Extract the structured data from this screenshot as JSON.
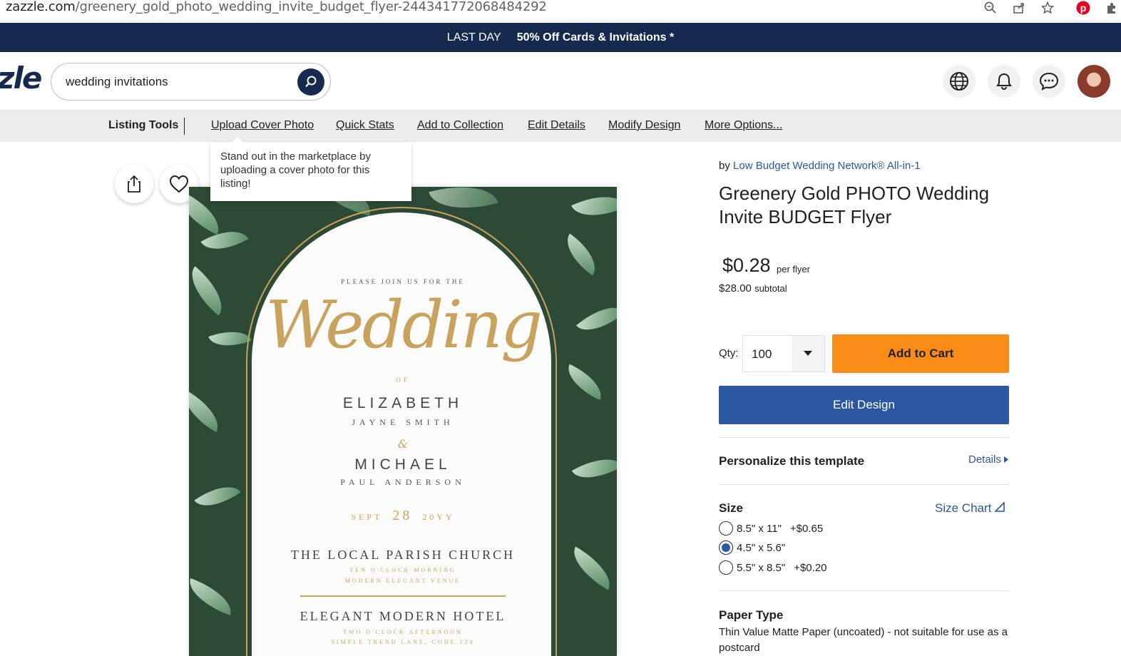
{
  "browser": {
    "url_domain": "zazzle.com",
    "url_path": "/greenery_gold_photo_wedding_invite_budget_flyer-244341772068484292",
    "icons": [
      "zoom-icon",
      "share-icon",
      "star-icon",
      "pinterest-icon",
      "extensions-icon"
    ]
  },
  "promo": {
    "day": "LAST DAY",
    "offer": "50% Off Cards & Invitations *"
  },
  "header": {
    "logo_fragment": "zle",
    "search_value": "wedding invitations",
    "icons": [
      "globe-icon",
      "bell-icon",
      "chat-icon",
      "avatar"
    ]
  },
  "listing_tools": {
    "title": "Listing Tools",
    "links": [
      "Upload Cover Photo",
      "Quick Stats",
      "Add to Collection",
      "Edit Details",
      "Modify Design",
      "More Options..."
    ],
    "tooltip": "Stand out in the marketplace by uploading a cover photo for this listing!"
  },
  "invite": {
    "join": "PLEASE JOIN US FOR THE",
    "wedding": "Wedding",
    "of": "OF",
    "name1": "ELIZABETH",
    "middle1": "JAYNE SMITH",
    "amp": "&",
    "name2": "MICHAEL",
    "middle2": "PAUL ANDERSON",
    "month": "SEPT",
    "day": "28",
    "year": "20YY",
    "venue1": "THE LOCAL PARISH CHURCH",
    "venue1_time": "TEN O'CLOCK MORNING",
    "venue1_addr": "MODERN ELEGANT VENUE",
    "venue2": "ELEGANT MODERN HOTEL",
    "venue2_time": "TWO O'CLOCK AFTERNOON",
    "venue2_addr": "SIMPLE TREND LANE, CODE 123"
  },
  "product": {
    "by_prefix": "by",
    "store": "Low Budget Wedding Network® All-in-1",
    "title": "Greenery Gold PHOTO Wedding Invite BUDGET Flyer",
    "price": "$0.28",
    "price_unit": "per flyer",
    "subtotal": "$28.00",
    "subtotal_label": "subtotal",
    "qty_label": "Qty:",
    "qty_value": "100",
    "add_to_cart": "Add to Cart",
    "edit_design": "Edit Design",
    "personalize": "Personalize this template",
    "details": "Details",
    "size_label": "Size",
    "size_chart": "Size Chart",
    "sizes": [
      {
        "label": "8.5\" x 11\"",
        "add": "+$0.65",
        "selected": false
      },
      {
        "label": "4.5\" x 5.6\"",
        "add": "",
        "selected": true
      },
      {
        "label": "5.5\" x 8.5\"",
        "add": "+$0.20",
        "selected": false
      }
    ],
    "paper_label": "Paper Type",
    "paper_desc": "Thin Value Matte Paper (uncoated) - not suitable for use as a postcard"
  },
  "colors": {
    "navy": "#16294f",
    "orange": "#f98c17",
    "blue": "#2b57a3",
    "gold": "#c9a35e",
    "green": "#2d4a36"
  }
}
